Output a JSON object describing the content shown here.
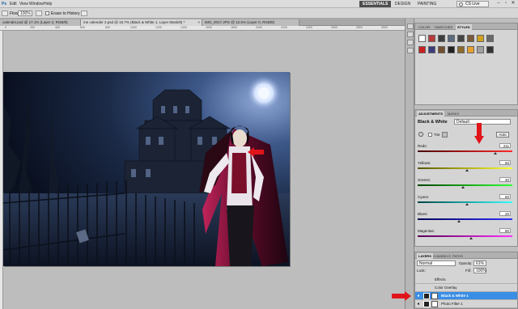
{
  "menubar": {
    "items": [
      "Ps",
      "Edit",
      "View",
      "Window",
      "Help"
    ],
    "workspaces": [
      "ESSENTIALS",
      "DESIGN",
      "PAINTING"
    ],
    "active_workspace": "ESSENTIALS",
    "cslive": "CS Live",
    "window_controls": [
      "–",
      "▫",
      "✕"
    ]
  },
  "options_bar": {
    "flow_label": "Flow:",
    "flow_value": "100%",
    "erase_history_label": "Erase to History"
  },
  "doc_tabs": [
    {
      "label": "calender.psd @ 17.1% (Layer 2, RGB/8)",
      "active": false
    },
    {
      "label": "me calender 2.psd @ 16.7% (Black & White 1, Layer Mask/8) *",
      "active": true
    },
    {
      "label": "IMG_0017.JPG @ 12.5% (Layer 0, RGB/8)",
      "active": false
    }
  ],
  "ruler": {
    "numbers": [
      "0",
      "200",
      "400",
      "600",
      "800",
      "1000",
      "1200",
      "1400",
      "1600",
      "1800",
      "2000",
      "2200",
      "2400",
      "2600",
      "2800",
      "3000"
    ]
  },
  "swatches_panel": {
    "tabs": [
      "COLOR",
      "SWATCHES",
      "STYLES"
    ],
    "active_tab": "STYLES",
    "style_colors": [
      "#ffffff",
      "#b83a3a",
      "#3d3d3d",
      "#5b6b80",
      "#444444",
      "#7a5a3a",
      "#d0a020",
      "#6a6a6a",
      "#cc2020",
      "#3c3c7c",
      "#705030",
      "#222222",
      "#8b6b2b",
      "#e8a030",
      "#a0a0a0",
      "#333333"
    ]
  },
  "adjustments_panel": {
    "tabs": [
      "ADJUSTMENTS",
      "MASKS"
    ],
    "active_tab": "ADJUSTMENTS",
    "title": "Black & White",
    "preset": "Default",
    "tint_label": "Tint",
    "auto_label": "Auto",
    "sliders": [
      {
        "label": "Reds:",
        "value": "211",
        "colors": [
          "#4a0000",
          "#ff2a2a"
        ]
      },
      {
        "label": "Yellows:",
        "value": "60",
        "colors": [
          "#555500",
          "#ffff30"
        ]
      },
      {
        "label": "Greens:",
        "value": "40",
        "colors": [
          "#004400",
          "#30ff30"
        ]
      },
      {
        "label": "Cyans:",
        "value": "60",
        "colors": [
          "#004444",
          "#30ffff"
        ]
      },
      {
        "label": "Blues:",
        "value": "20",
        "colors": [
          "#000055",
          "#3030ff"
        ]
      },
      {
        "label": "Magentas:",
        "value": "80",
        "colors": [
          "#550055",
          "#ff30ff"
        ]
      }
    ]
  },
  "layers_panel": {
    "tabs": [
      "LAYERS",
      "CHANNELS",
      "PATHS"
    ],
    "active_tab": "LAYERS",
    "blend_mode": "Normal",
    "opacity_label": "Opacity:",
    "opacity_value": "61%",
    "lock_label": "Lock:",
    "fill_label": "Fill:",
    "fill_value": "100%",
    "rows": [
      {
        "label": "Effects",
        "indent": true,
        "selected": false
      },
      {
        "label": "Color Overlay",
        "indent": true,
        "selected": false
      },
      {
        "label": "Black & White 1",
        "indent": false,
        "selected": true
      },
      {
        "label": "Photo Filter 1",
        "indent": false,
        "selected": false
      }
    ]
  },
  "colors": {
    "accent_red": "#e0151a",
    "selection_blue": "#3a8ee6"
  }
}
